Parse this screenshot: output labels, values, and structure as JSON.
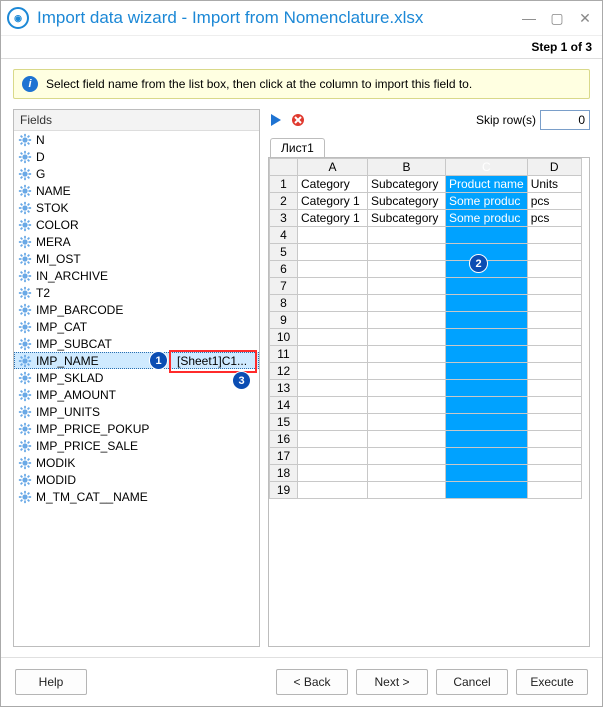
{
  "window": {
    "title": "Import data wizard - Import from Nomenclature.xlsx",
    "step_label": "Step 1 of 3"
  },
  "info": {
    "text": "Select field name from the list box, then click at the column to import this field to."
  },
  "fields_panel": {
    "header": "Fields",
    "items": [
      {
        "name": "N"
      },
      {
        "name": "D"
      },
      {
        "name": "G"
      },
      {
        "name": "NAME"
      },
      {
        "name": "STOK"
      },
      {
        "name": "COLOR"
      },
      {
        "name": "MERA"
      },
      {
        "name": "MI_OST"
      },
      {
        "name": "IN_ARCHIVE"
      },
      {
        "name": "T2"
      },
      {
        "name": "IMP_BARCODE"
      },
      {
        "name": "IMP_CAT"
      },
      {
        "name": "IMP_SUBCAT"
      },
      {
        "name": "IMP_NAME",
        "selected": true,
        "mapping": "[Sheet1]C1..."
      },
      {
        "name": "IMP_SKLAD"
      },
      {
        "name": "IMP_AMOUNT"
      },
      {
        "name": "IMP_UNITS"
      },
      {
        "name": "IMP_PRICE_POKUP"
      },
      {
        "name": "IMP_PRICE_SALE"
      },
      {
        "name": "MODIK"
      },
      {
        "name": "MODID"
      },
      {
        "name": "M_TM_CAT__NAME"
      }
    ]
  },
  "right": {
    "skip_label": "Skip row(s)",
    "skip_value": "0",
    "tab_label": "Лист1",
    "columns": [
      "A",
      "B",
      "C",
      "D"
    ],
    "rows": [
      {
        "n": "1",
        "cells": [
          "Category",
          "Subcategory",
          "Product name",
          "Units"
        ]
      },
      {
        "n": "2",
        "cells": [
          "Category 1",
          "Subcategory",
          "Some produc",
          "pcs"
        ]
      },
      {
        "n": "3",
        "cells": [
          "Category 1",
          "Subcategory",
          "Some produc",
          "pcs"
        ]
      },
      {
        "n": "4",
        "cells": [
          "",
          "",
          "",
          ""
        ]
      },
      {
        "n": "5",
        "cells": [
          "",
          "",
          "",
          ""
        ]
      },
      {
        "n": "6",
        "cells": [
          "",
          "",
          "",
          ""
        ]
      },
      {
        "n": "7",
        "cells": [
          "",
          "",
          "",
          ""
        ]
      },
      {
        "n": "8",
        "cells": [
          "",
          "",
          "",
          ""
        ]
      },
      {
        "n": "9",
        "cells": [
          "",
          "",
          "",
          ""
        ]
      },
      {
        "n": "10",
        "cells": [
          "",
          "",
          "",
          ""
        ]
      },
      {
        "n": "11",
        "cells": [
          "",
          "",
          "",
          ""
        ]
      },
      {
        "n": "12",
        "cells": [
          "",
          "",
          "",
          ""
        ]
      },
      {
        "n": "13",
        "cells": [
          "",
          "",
          "",
          ""
        ]
      },
      {
        "n": "14",
        "cells": [
          "",
          "",
          "",
          ""
        ]
      },
      {
        "n": "15",
        "cells": [
          "",
          "",
          "",
          ""
        ]
      },
      {
        "n": "16",
        "cells": [
          "",
          "",
          "",
          ""
        ]
      },
      {
        "n": "17",
        "cells": [
          "",
          "",
          "",
          ""
        ]
      },
      {
        "n": "18",
        "cells": [
          "",
          "",
          "",
          ""
        ]
      },
      {
        "n": "19",
        "cells": [
          "",
          "",
          "",
          ""
        ]
      }
    ],
    "selected_column_index": 2
  },
  "footer": {
    "help": "Help",
    "back": "< Back",
    "next": "Next >",
    "cancel": "Cancel",
    "execute": "Execute"
  },
  "annotations": {
    "1": "1",
    "2": "2",
    "3": "3"
  }
}
